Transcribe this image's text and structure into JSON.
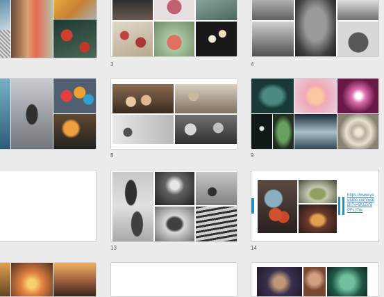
{
  "slides": {
    "s3": {
      "number": "3"
    },
    "s4": {
      "number": "4"
    },
    "s8": {
      "number": "8"
    },
    "s9": {
      "number": "9"
    },
    "s13": {
      "number": "13"
    },
    "s14": {
      "number": "14",
      "link": "https://www.youtube.com/watch?v=BUZVSPFsJ7rk"
    }
  },
  "colors": {
    "background": "#ececec",
    "slide": "#ffffff",
    "accent_bar": "#2a8fc0",
    "link": "#2b7fb8"
  }
}
